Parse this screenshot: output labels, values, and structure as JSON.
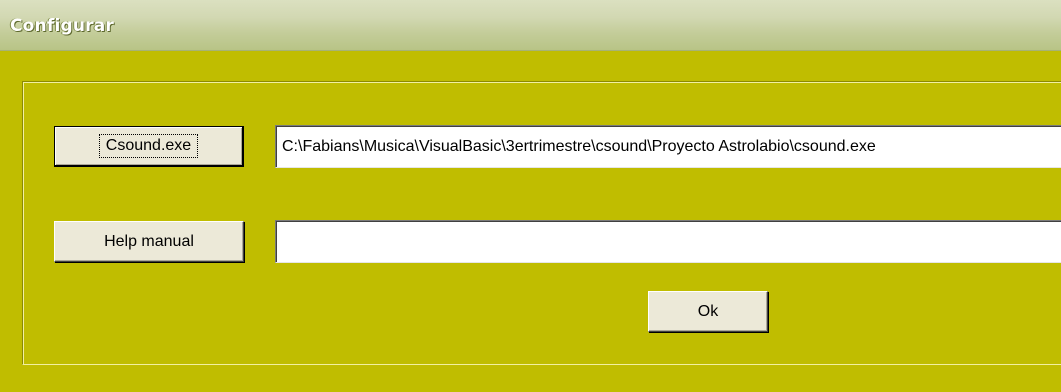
{
  "window": {
    "title": "Configurar"
  },
  "form": {
    "csound_button_label": "Csound.exe",
    "csound_path_value": "C:\\Fabians\\Musica\\VisualBasic\\3ertrimestre\\csound\\Proyecto Astrolabio\\csound.exe",
    "help_button_label": "Help manual",
    "help_path_value": "",
    "ok_button_label": "Ok"
  },
  "colors": {
    "background": "#c0bd00",
    "button_face": "#ece9d8",
    "titlebar": "#d2d8b2"
  }
}
